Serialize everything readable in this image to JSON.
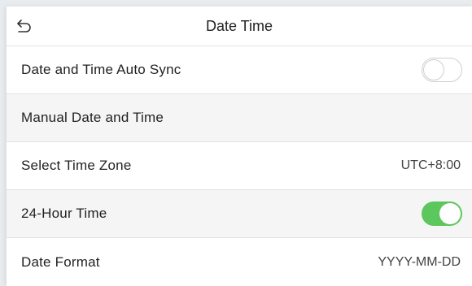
{
  "header": {
    "title": "Date Time",
    "back_icon": "back-arrow-icon"
  },
  "colors": {
    "toggle_on": "#5cc75c",
    "toggle_off_border": "#cfcfcf",
    "row_shaded": "#f5f5f5"
  },
  "rows": [
    {
      "label": "Date and Time Auto Sync",
      "toggle": "off"
    },
    {
      "label": "Manual Date and Time"
    },
    {
      "label": "Select Time Zone",
      "value": "UTC+8:00"
    },
    {
      "label": "24-Hour Time",
      "toggle": "on"
    },
    {
      "label": "Date Format",
      "value": "YYYY-MM-DD"
    }
  ]
}
